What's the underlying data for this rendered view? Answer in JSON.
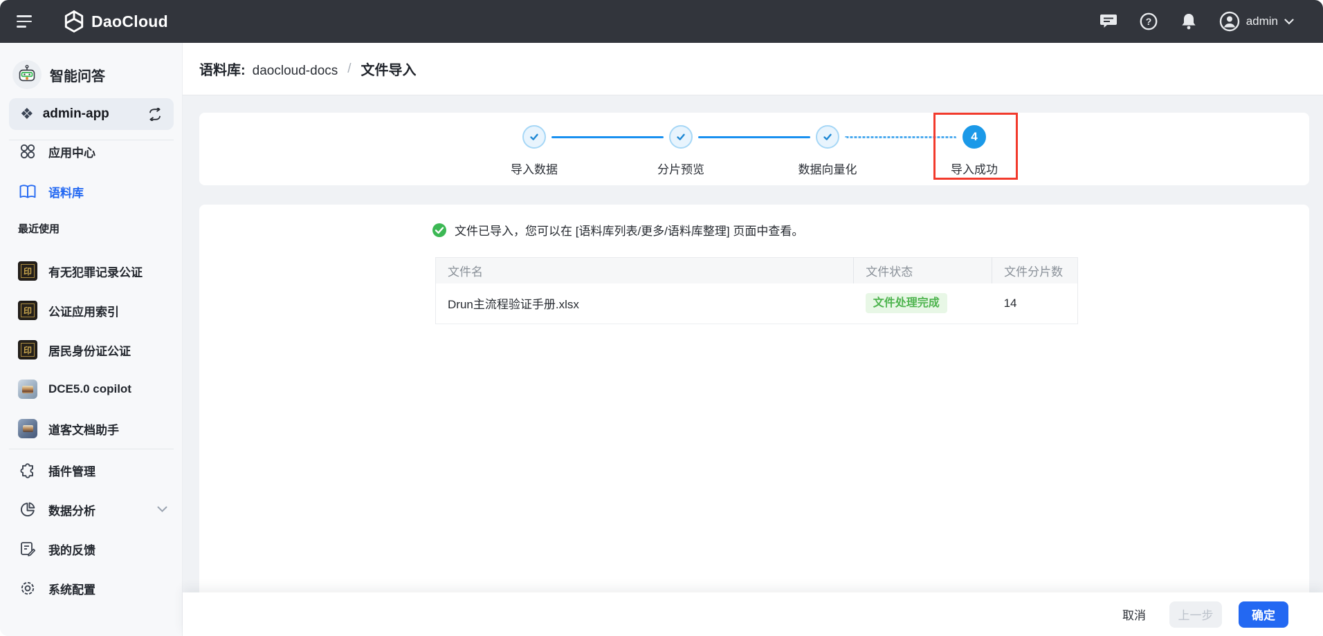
{
  "navbar": {
    "brand": "DaoCloud",
    "username": "admin"
  },
  "sidebar": {
    "app_title": "智能问答",
    "current_app": "admin-app",
    "nav_items": [
      {
        "label": "应用中心",
        "active": false
      },
      {
        "label": "语料库",
        "active": true
      }
    ],
    "recent_title": "最近使用",
    "recent_items": [
      "有无犯罪记录公证",
      "公证应用索引",
      "居民身份证公证",
      "DCE5.0 copilot",
      "道客文档助手"
    ],
    "bottom_items": [
      "插件管理",
      "数据分析",
      "我的反馈",
      "系统配置"
    ],
    "seal_glyph": "印"
  },
  "breadcrumb": {
    "label": "语料库:",
    "corpus_name": "daocloud-docs",
    "separator": "/",
    "current": "文件导入"
  },
  "stepper": {
    "steps": [
      {
        "label": "导入数据",
        "state": "done"
      },
      {
        "label": "分片预览",
        "state": "done"
      },
      {
        "label": "数据向量化",
        "state": "done"
      },
      {
        "label": "导入成功",
        "state": "current",
        "number": "4"
      }
    ],
    "annotated_step": "导入成功"
  },
  "content": {
    "success_message": "文件已导入，您可以在 [语料库列表/更多/语料库整理] 页面中查看。",
    "table": {
      "columns": [
        "文件名",
        "文件状态",
        "文件分片数"
      ],
      "rows": [
        {
          "file_name": "Drun主流程验证手册.xlsx",
          "status": "文件处理完成",
          "chunk_count": "14"
        }
      ]
    }
  },
  "footer": {
    "cancel_label": "取消",
    "prev_label": "上一步",
    "confirm_label": "确定"
  },
  "colors": {
    "navbar_bg": "#32353c",
    "accent_blue": "#2368f2",
    "stepper_circle_blue": "#1b99e8",
    "stepper_line_blue": "#1890f0",
    "annotation_red": "#f23a2c",
    "success_green": "#3cb854",
    "badge_green_bg": "#e8f7e6",
    "badge_green_text": "#4eb44e",
    "sidebar_bg": "#f7f8fa",
    "main_bg": "#f0f2f5"
  }
}
